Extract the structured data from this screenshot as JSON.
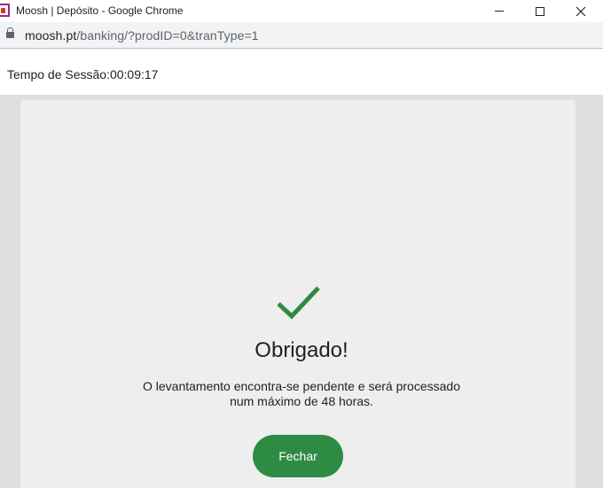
{
  "window": {
    "title": "Moosh | Depósito - Google Chrome"
  },
  "address": {
    "domain": "moosh.pt",
    "path": "/banking/?prodID=0&tranType=1"
  },
  "session": {
    "label": "Tempo de Sessão:00:09:17"
  },
  "confirmation": {
    "icon": "check-icon",
    "heading": "Obrigado!",
    "message_line1": "O levantamento encontra-se pendente e será processado",
    "message_line2": "num máximo de 48 horas.",
    "button_label": "Fechar"
  },
  "colors": {
    "accent": "#2e8b44",
    "card_bg": "#eeeeee",
    "page_bg": "#dfdfdf"
  }
}
